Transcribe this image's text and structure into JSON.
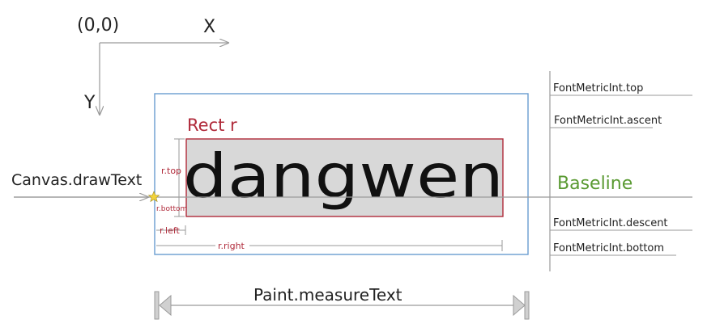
{
  "origin_label": "(0,0)",
  "x_axis_label": "X",
  "y_axis_label": "Y",
  "rect_label": "Rect r",
  "sample_text": "dangwen",
  "draw_text_label": "Canvas.drawText",
  "baseline_label": "Baseline",
  "r_top_label": "r.top",
  "r_bottom_label": "r.bottom",
  "r_left_label": "r.left",
  "r_right_label": "r.right",
  "metrics": {
    "top": "FontMetricInt.top",
    "ascent": "FontMetricInt.ascent",
    "descent": "FontMetricInt.descent",
    "bottom": "FontMetricInt.bottom"
  },
  "measure_label": "Paint.measureText",
  "colors": {
    "outer_box": "#6a9cd0",
    "rect_border": "#b02a3a",
    "rect_fill": "#d8d8d8",
    "guide": "#9a9a9a",
    "baseline_text": "#5a9a32",
    "star": "#f2d33a"
  }
}
